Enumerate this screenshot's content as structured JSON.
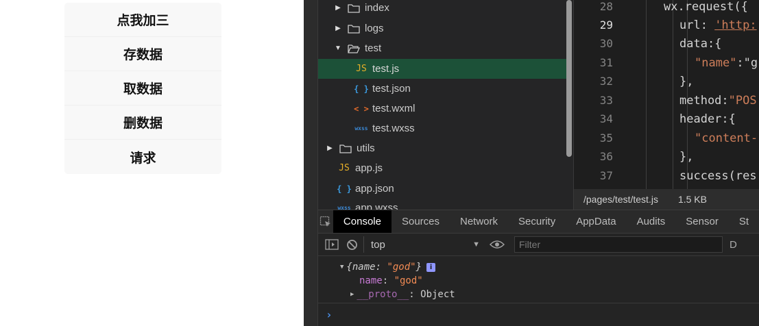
{
  "simulator": {
    "buttons": [
      {
        "label": "点我加三"
      },
      {
        "label": "存数据"
      },
      {
        "label": "取数据"
      },
      {
        "label": "删数据"
      },
      {
        "label": "请求"
      }
    ]
  },
  "file_tree": {
    "items": [
      {
        "label": "index",
        "type": "folder",
        "state": "collapsed"
      },
      {
        "label": "logs",
        "type": "folder",
        "state": "collapsed"
      },
      {
        "label": "test",
        "type": "folder",
        "state": "expanded"
      },
      {
        "label": "test.js",
        "type": "js",
        "badge": "JS",
        "selected": true
      },
      {
        "label": "test.json",
        "type": "json",
        "badge": "{ }"
      },
      {
        "label": "test.wxml",
        "type": "wxml",
        "badge": "< >"
      },
      {
        "label": "test.wxss",
        "type": "wxss",
        "badge": "wxss"
      },
      {
        "label": "utils",
        "type": "folder",
        "state": "collapsed"
      },
      {
        "label": "app.js",
        "type": "js",
        "badge": "JS"
      },
      {
        "label": "app.json",
        "type": "json",
        "badge": "{ }"
      },
      {
        "label": "app.wxss",
        "type": "wxss",
        "badge": "wxss"
      }
    ]
  },
  "editor": {
    "active_line": "29",
    "lines": [
      {
        "no": "28",
        "code": "wx.request({"
      },
      {
        "no": "29",
        "pre": "url: ",
        "str": "'http:"
      },
      {
        "no": "30",
        "code": "data:{"
      },
      {
        "no": "31",
        "str": "\"name\"",
        "post": ":\"g"
      },
      {
        "no": "32",
        "code": "},"
      },
      {
        "no": "33",
        "pre": "method:",
        "str": "\"POS"
      },
      {
        "no": "34",
        "code": "header:{"
      },
      {
        "no": "35",
        "str": "\"content-"
      },
      {
        "no": "36",
        "code": "},"
      },
      {
        "no": "37",
        "code": "success(res"
      }
    ]
  },
  "status_bar": {
    "path": "/pages/test/test.js",
    "size": "1.5 KB"
  },
  "devtools": {
    "tabs": [
      "Console",
      "Sources",
      "Network",
      "Security",
      "AppData",
      "Audits",
      "Sensor",
      "St"
    ],
    "active_tab": "Console"
  },
  "console": {
    "context": "top",
    "filter_placeholder": "Filter",
    "trailing_label": "D",
    "object_preview": {
      "open": "{",
      "key": "name",
      "sep": ": ",
      "value": "\"god\"",
      "close": "}"
    },
    "property": {
      "key": "name",
      "sep": ": ",
      "value": "\"god\""
    },
    "proto": {
      "key": "__proto__",
      "sep": ": ",
      "value": "Object"
    },
    "info_badge": "i"
  },
  "colors": {
    "selected_file_bg": "#1c5138",
    "active_tab_bg": "#000000",
    "string_color": "#ce7e5a",
    "console_key": "#c77ad4",
    "console_value": "#f28b54",
    "prompt_color": "#4a8fe7"
  }
}
